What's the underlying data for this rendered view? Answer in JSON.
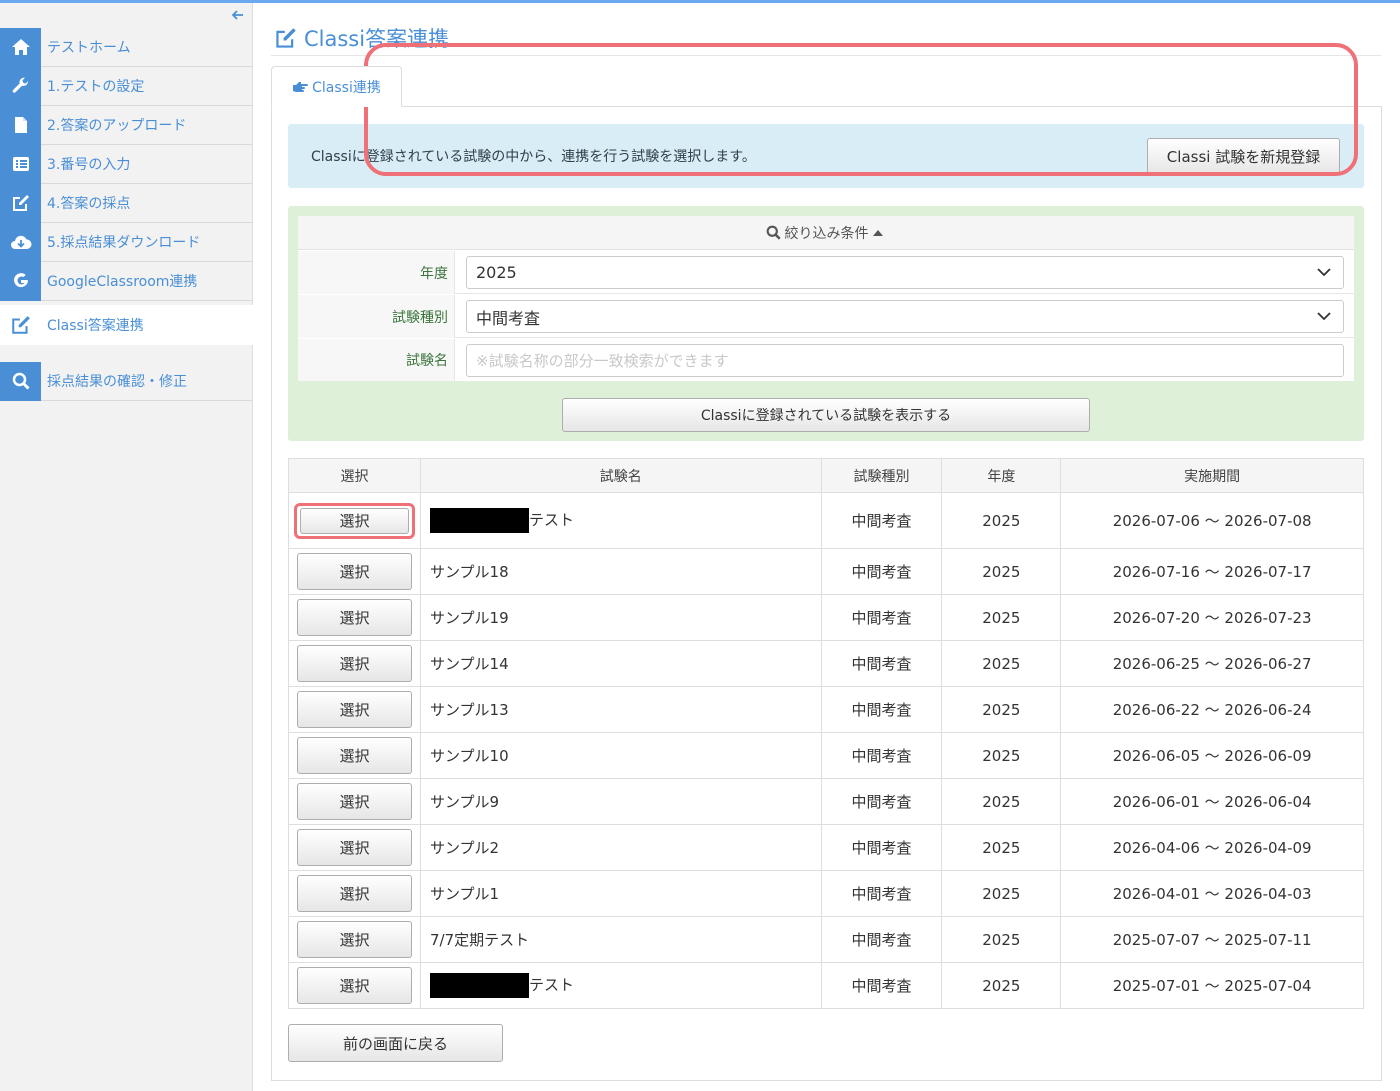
{
  "sidebar": {
    "items": [
      {
        "label": "テストホーム",
        "icon": "home-icon"
      },
      {
        "label": "1.テストの設定",
        "icon": "wrench-icon"
      },
      {
        "label": "2.答案のアップロード",
        "icon": "file-icon"
      },
      {
        "label": "3.番号の入力",
        "icon": "list-icon"
      },
      {
        "label": "4.答案の採点",
        "icon": "edit-icon"
      },
      {
        "label": "5.採点結果ダウンロード",
        "icon": "cloud-download-icon"
      },
      {
        "label": "GoogleClassroom連携",
        "icon": "google-icon"
      },
      {
        "label": "Classi答案連携",
        "icon": "edit-icon",
        "active": true
      },
      {
        "label": "採点結果の確認・修正",
        "icon": "search-icon"
      }
    ]
  },
  "page": {
    "title": "Classi答案連携",
    "tab": "Classi連携"
  },
  "info": {
    "message": "Classiに登録されている試験の中から、連携を行う試験を選択します。",
    "new_button": "Classi 試験を新規登録"
  },
  "filter": {
    "header": "絞り込み条件",
    "year_label": "年度",
    "year_value": "2025",
    "type_label": "試験種別",
    "type_value": "中間考査",
    "name_label": "試験名",
    "name_placeholder": "※試験名称の部分一致検索ができます",
    "show_button": "Classiに登録されている試験を表示する"
  },
  "table": {
    "headers": [
      "選択",
      "試験名",
      "試験種別",
      "年度",
      "実施期間"
    ],
    "select_label": "選択",
    "rows": [
      {
        "name": "テスト",
        "redacted": true,
        "type": "中間考査",
        "year": "2025",
        "period": "2026-07-06 〜 2026-07-08"
      },
      {
        "name": "サンプル18",
        "type": "中間考査",
        "year": "2025",
        "period": "2026-07-16 〜 2026-07-17"
      },
      {
        "name": "サンプル19",
        "type": "中間考査",
        "year": "2025",
        "period": "2026-07-20 〜 2026-07-23"
      },
      {
        "name": "サンプル14",
        "type": "中間考査",
        "year": "2025",
        "period": "2026-06-25 〜 2026-06-27"
      },
      {
        "name": "サンプル13",
        "type": "中間考査",
        "year": "2025",
        "period": "2026-06-22 〜 2026-06-24"
      },
      {
        "name": "サンプル10",
        "type": "中間考査",
        "year": "2025",
        "period": "2026-06-05 〜 2026-06-09"
      },
      {
        "name": "サンプル9",
        "type": "中間考査",
        "year": "2025",
        "period": "2026-06-01 〜 2026-06-04"
      },
      {
        "name": "サンプル2",
        "type": "中間考査",
        "year": "2025",
        "period": "2026-04-06 〜 2026-04-09"
      },
      {
        "name": "サンプル1",
        "type": "中間考査",
        "year": "2025",
        "period": "2026-04-01 〜 2026-04-03"
      },
      {
        "name": "7/7定期テスト",
        "type": "中間考査",
        "year": "2025",
        "period": "2025-07-07 〜 2025-07-11"
      },
      {
        "name": "テスト",
        "redacted": true,
        "type": "中間考査",
        "year": "2025",
        "period": "2025-07-01 〜 2025-07-04"
      }
    ]
  },
  "back_button": "前の画面に戻る",
  "colors": {
    "accent": "#4a8fd6",
    "info_bg": "#d9edf7",
    "filter_bg": "#dff0d8",
    "highlight": "#f07077"
  }
}
